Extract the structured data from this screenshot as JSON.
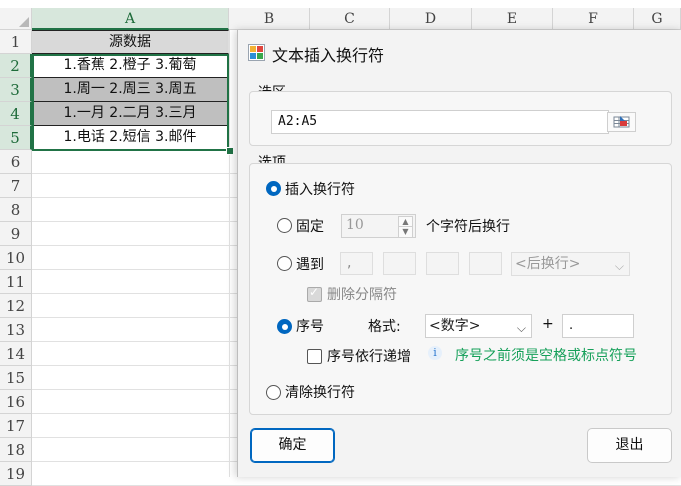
{
  "sheet": {
    "columns": [
      "A",
      "B",
      "C",
      "D",
      "E",
      "F",
      "G"
    ],
    "rows": [
      "1",
      "2",
      "3",
      "4",
      "5",
      "6",
      "7",
      "8",
      "9",
      "10",
      "11",
      "12",
      "13",
      "14",
      "15",
      "16",
      "17",
      "18",
      "19"
    ],
    "cells": [
      "源数据",
      "1.香蕉 2.橙子 3.葡萄",
      "1.周一 2.周三 3.周五",
      "1.一月 2.二月 3.三月",
      "1.电话 2.短信 3.邮件"
    ]
  },
  "dialog": {
    "title": "文本插入换行符",
    "selection_label": "选区",
    "range_value": "A2:A5",
    "options_label": "选项",
    "insert_label": "插入换行符",
    "fixed_label": "固定",
    "fixed_value": "10",
    "fixed_suffix": "个字符后换行",
    "meet_label": "遇到",
    "meet_fields": [
      ",",
      "",
      "",
      ""
    ],
    "meet_position": "<后换行>",
    "delete_sep_label": "删除分隔符",
    "serial_label": "序号",
    "format_label": "格式:",
    "format_value": "<数字>",
    "plus_label": "+",
    "suffix_value": ".",
    "increment_label": "序号依行递增",
    "hint_text": "序号之前须是空格或标点符号",
    "clear_label": "清除换行符",
    "ok_label": "确定",
    "exit_label": "退出"
  },
  "colors": {
    "accent": "#0067c0",
    "selection": "#217346",
    "hint": "#16a05a"
  }
}
